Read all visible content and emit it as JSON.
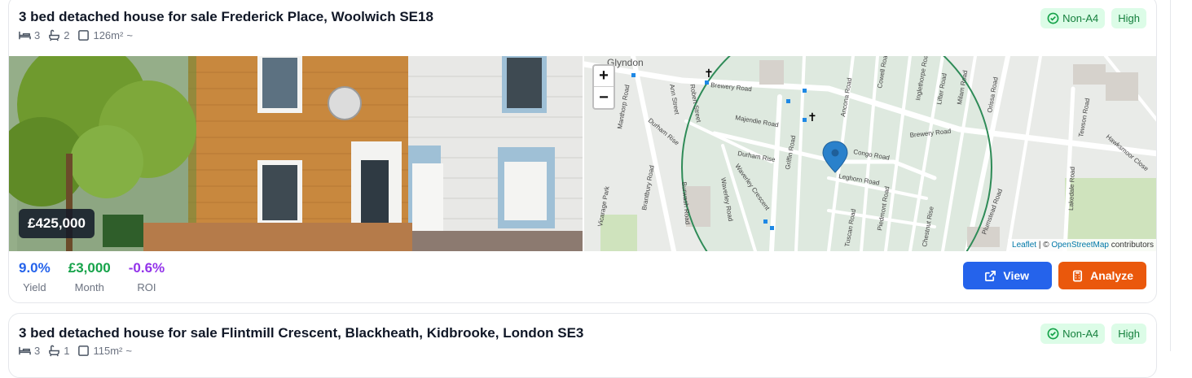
{
  "listings": [
    {
      "title": "3 bed detached house for sale Frederick Place, Woolwich SE18",
      "bedrooms": "3",
      "bathrooms": "2",
      "area": "126m²",
      "area_suffix": "~",
      "badges": {
        "epc": "Non-A4",
        "level": "High"
      },
      "price": "£425,000",
      "stats": [
        {
          "value": "9.0%",
          "label": "Yield",
          "color": "#2563eb"
        },
        {
          "value": "£3,000",
          "label": "Month",
          "color": "#16a34a"
        },
        {
          "value": "-0.6%",
          "label": "ROI",
          "color": "#9333ea"
        }
      ],
      "actions": {
        "view": "View",
        "analyze": "Analyze"
      },
      "map": {
        "zoom_in": "+",
        "zoom_out": "−",
        "attribution_leaflet": "Leaflet",
        "attribution_sep": "| ©",
        "attribution_osm": "OpenStreetMap",
        "attribution_rest": "contributors",
        "labels": [
          "Glyndon",
          "Brewery Road",
          "Majendie Road",
          "Durham Rise",
          "Durham Rise",
          "Waverley Crescent",
          "Griffin Road",
          "Congo Road",
          "Leghorn Road",
          "Ancona Road",
          "Brewery Road",
          "Orissa Road",
          "Tewson Road",
          "Hawksmoor Close",
          "Lakedale Road",
          "Plumstead Road",
          "Tuscan Road",
          "Piedmont Road",
          "Chestnut Rise",
          "Vicarage Park",
          "Brantbury Road",
          "Manthorp Road",
          "Durham Road",
          "Ann Street",
          "Robert Street",
          "Cowell Road",
          "Inglethorpe Road",
          "Lifter Road",
          "Milam Road",
          "Waverley Road",
          "Burwash Road",
          "Parkdale Road"
        ]
      }
    },
    {
      "title": "3 bed detached house for sale Flintmill Crescent, Blackheath, Kidbrooke, London SE3",
      "bedrooms": "3",
      "bathrooms": "1",
      "area": "115m²",
      "area_suffix": "~",
      "badges": {
        "epc": "Non-A4",
        "level": "High"
      }
    }
  ],
  "colors": {
    "epc_badge": "#15803d",
    "view_button": "#2563eb",
    "analyze_button": "#ea580c",
    "radius_circle": "#2e8b57",
    "map_pin": "#2a81cb"
  },
  "icons": [
    "bed-icon",
    "bath-icon",
    "area-icon",
    "check-circle-icon",
    "external-link-icon",
    "calculator-icon",
    "map-pin-icon",
    "church-icon"
  ]
}
